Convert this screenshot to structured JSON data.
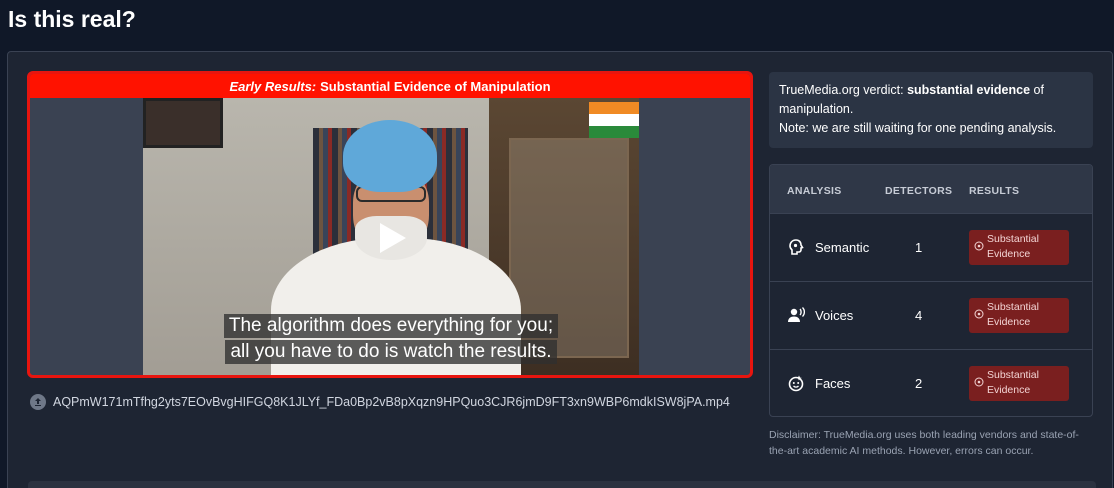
{
  "page": {
    "title": "Is this real?"
  },
  "media": {
    "banner_prefix": "Early Results:",
    "banner_text": "Substantial Evidence of Manipulation",
    "caption_line1": "The algorithm does everything for you;",
    "caption_line2": "all you have to do is watch the results.",
    "filename": "AQPmW171mTfhg2yts7EOvBvgHIFGQ8K1JLYf_FDa0Bp2vB8pXqzn9HPQuo3CJR6jmD9FT3xn9WBP6mdkISW8jPA.mp4",
    "icons": {
      "play": "play-icon",
      "file": "upload-file-icon"
    }
  },
  "verdict": {
    "prefix": "TrueMedia.org verdict: ",
    "strong": "substantial evidence",
    "suffix": " of manipulation.",
    "note": "Note: we are still waiting for one pending analysis."
  },
  "table": {
    "headers": {
      "analysis": "ANALYSIS",
      "detectors": "DETECTORS",
      "results": "RESULTS"
    },
    "rows": [
      {
        "label": "Semantic",
        "detectors": "1",
        "result": "Substantial Evidence",
        "icon": "semantic-brain-icon"
      },
      {
        "label": "Voices",
        "detectors": "4",
        "result": "Substantial Evidence",
        "icon": "voice-icon"
      },
      {
        "label": "Faces",
        "detectors": "2",
        "result": "Substantial Evidence",
        "icon": "face-icon"
      }
    ]
  },
  "disclaimer": "Disclaimer: TrueMedia.org uses both leading vendors and state-of-the-art academic AI methods. However, errors can occur.",
  "colors": {
    "banner_red": "#ff1200",
    "badge_red": "#7a1f1f",
    "background": "#101828"
  }
}
